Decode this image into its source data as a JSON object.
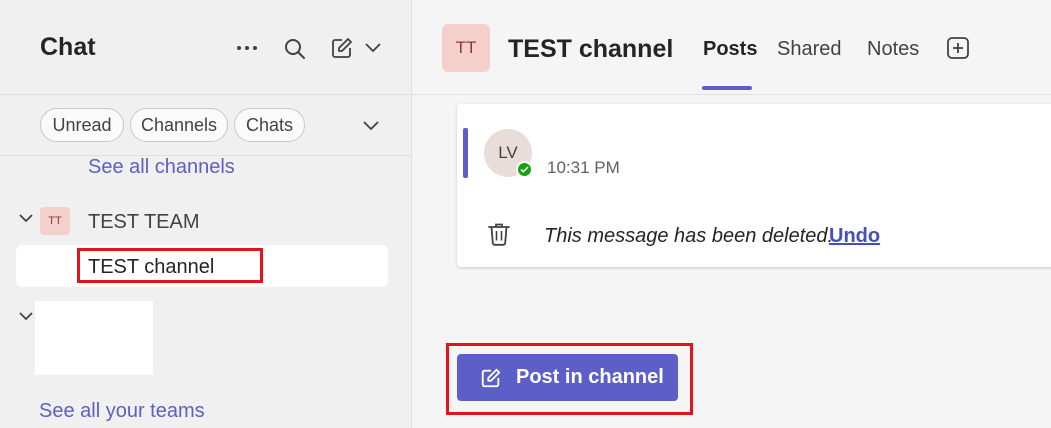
{
  "left_panel": {
    "title": "Chat",
    "header_icons": [
      "more-options-icon",
      "search-icon",
      "compose-icon",
      "chevron-down-icon"
    ],
    "filters": [
      "Unread",
      "Channels",
      "Chats"
    ],
    "see_all_channels": "See all channels",
    "team": {
      "avatar_initials": "TT",
      "name": "TEST TEAM",
      "channel": "TEST channel"
    },
    "see_all_teams": "See all your teams"
  },
  "channel_header": {
    "avatar_initials": "TT",
    "title": "TEST channel",
    "tabs": [
      "Posts",
      "Shared",
      "Notes"
    ],
    "active_tab": "Posts"
  },
  "message": {
    "avatar_initials": "LV",
    "time": "10:31 PM",
    "deleted_text": "This message has been deleted.",
    "undo_label": "Undo"
  },
  "post_button_label": "Post in channel",
  "colors": {
    "accent": "#5b5fc7",
    "highlight": "#e0131f",
    "presence": "#13a10e"
  }
}
